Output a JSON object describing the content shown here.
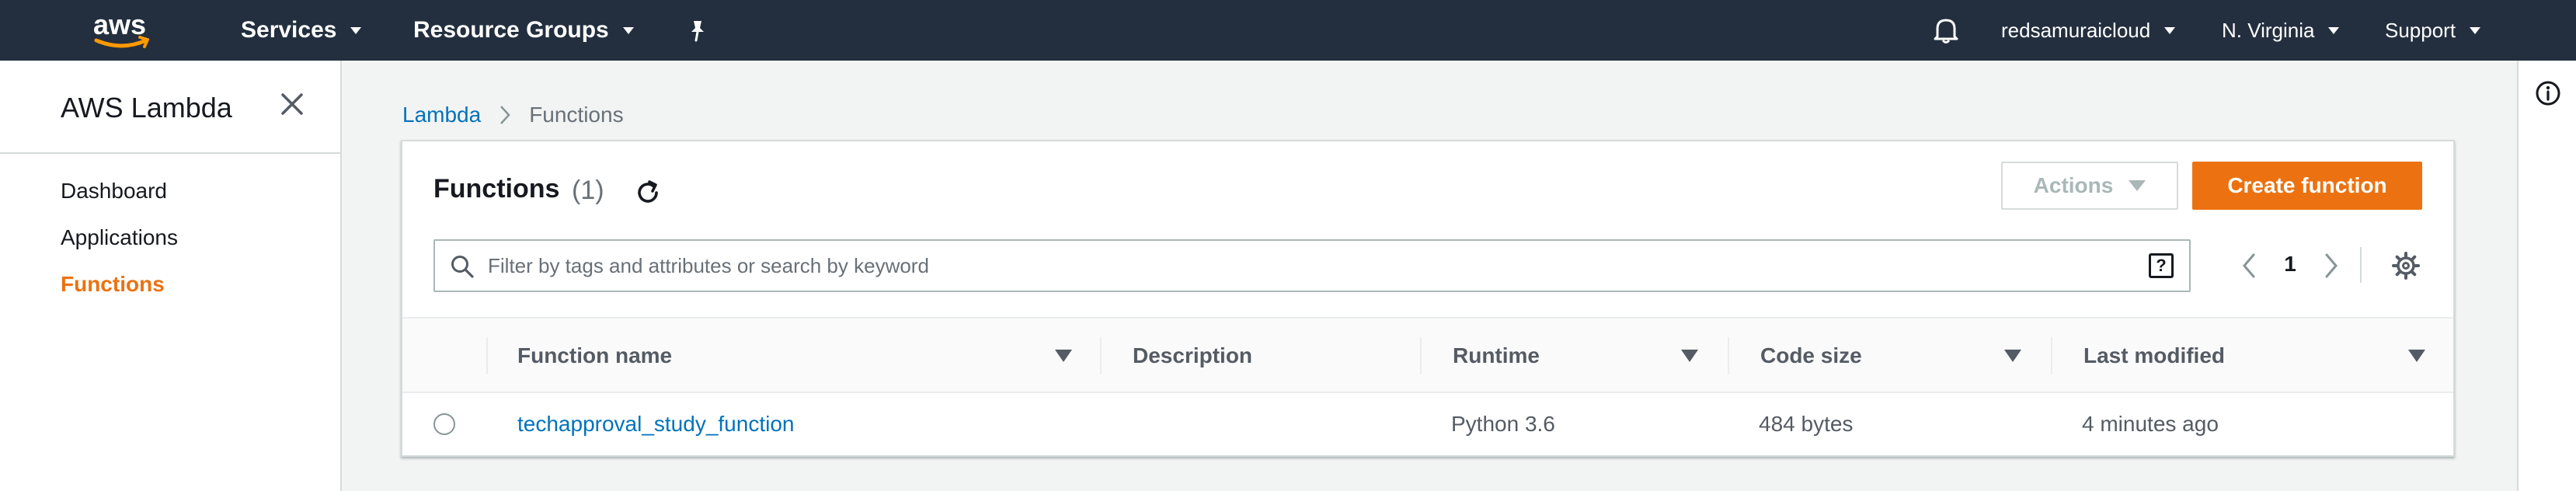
{
  "topnav": {
    "logo_text": "aws",
    "services_label": "Services",
    "resource_groups_label": "Resource Groups",
    "account_label": "redsamuraicloud",
    "region_label": "N. Virginia",
    "support_label": "Support"
  },
  "sidebar": {
    "title": "AWS Lambda",
    "items": [
      {
        "label": "Dashboard",
        "active": false
      },
      {
        "label": "Applications",
        "active": false
      },
      {
        "label": "Functions",
        "active": true
      }
    ]
  },
  "breadcrumb": {
    "root": "Lambda",
    "current": "Functions"
  },
  "panel": {
    "title": "Functions",
    "count": "(1)",
    "actions_label": "Actions",
    "create_label": "Create function",
    "search_placeholder": "Filter by tags and attributes or search by keyword",
    "help_glyph": "?",
    "page_number": "1"
  },
  "table": {
    "columns": [
      "Function name",
      "Description",
      "Runtime",
      "Code size",
      "Last modified"
    ],
    "rows": [
      {
        "function_name": "techapproval_study_function",
        "description": "",
        "runtime": "Python 3.6",
        "code_size": "484 bytes",
        "last_modified": "4 minutes ago"
      }
    ]
  },
  "colors": {
    "nav_bg": "#232f3e",
    "accent": "#ec7211",
    "link": "#0073bb"
  },
  "icons": [
    "pin-icon",
    "bell-icon",
    "close-icon",
    "info-icon",
    "refresh-icon",
    "search-icon",
    "help-icon",
    "chevron-left-icon",
    "chevron-right-icon",
    "gear-icon"
  ]
}
